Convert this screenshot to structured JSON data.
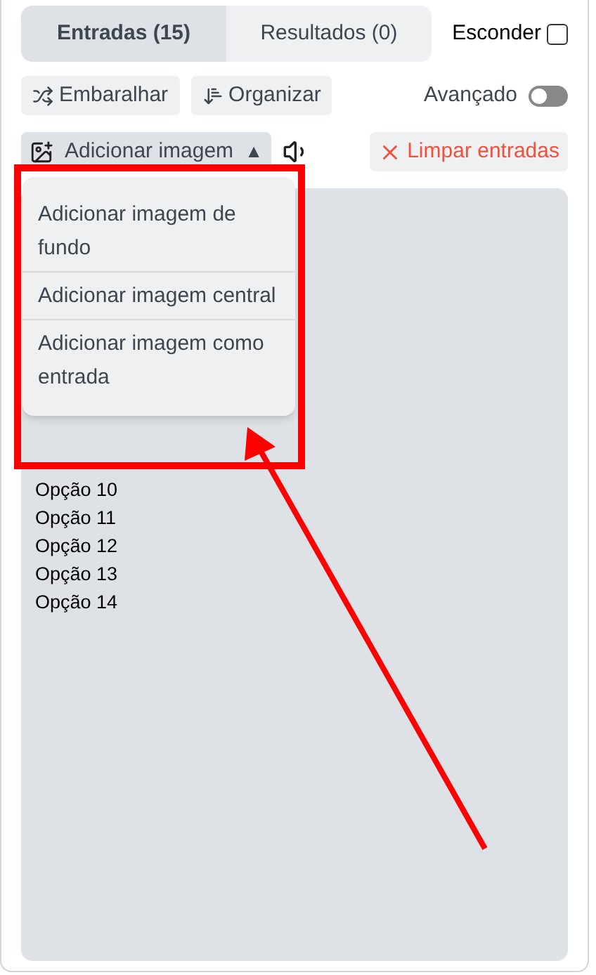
{
  "tabs": [
    {
      "label": "Entradas (15)",
      "selected": true
    },
    {
      "label": "Resultados (0)",
      "selected": false
    }
  ],
  "hide": {
    "label": "Esconder",
    "checked": false
  },
  "toolbar": {
    "shuffle": "Embaralhar",
    "sort": "Organizar"
  },
  "advanced": {
    "label": "Avançado",
    "on": false
  },
  "add_image": {
    "label": "Adicionar imagem",
    "caret": "▲",
    "expanded": true
  },
  "clear": {
    "label": "Limpar entradas"
  },
  "menu": [
    {
      "label": "Adicionar imagem de fundo"
    },
    {
      "label": "Adicionar imagem central"
    },
    {
      "label": "Adicionar imagem como entrada"
    }
  ],
  "entries": [
    "Opção 10",
    "Opção 11",
    "Opção 12",
    "Opção 13",
    "Opção 14"
  ]
}
